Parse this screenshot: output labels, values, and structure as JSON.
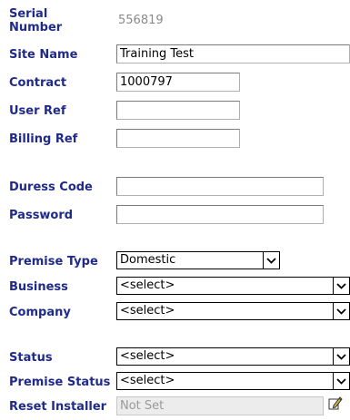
{
  "form": {
    "serial_number": {
      "label": "Serial Number",
      "value": "556819"
    },
    "site_name": {
      "label": "Site Name",
      "value": "Training Test"
    },
    "contract": {
      "label": "Contract",
      "value": "1000797"
    },
    "user_ref": {
      "label": "User Ref",
      "value": ""
    },
    "billing_ref": {
      "label": "Billing Ref",
      "value": ""
    },
    "duress_code": {
      "label": "Duress Code",
      "value": ""
    },
    "password": {
      "label": "Password",
      "value": ""
    },
    "premise_type": {
      "label": "Premise Type",
      "selected": "Domestic"
    },
    "business": {
      "label": "Business",
      "selected": "<select>"
    },
    "company": {
      "label": "Company",
      "selected": "<select>"
    },
    "status": {
      "label": "Status",
      "selected": "<select>"
    },
    "premise_status": {
      "label": "Premise Status",
      "selected": "<select>"
    },
    "reset_installer": {
      "label": "Reset Installer",
      "value": "Not Set"
    }
  },
  "icons": {
    "edit": "edit-pencil-icon"
  },
  "colors": {
    "label": "#1f2a8a",
    "read_only_value": "#8a8a8a"
  }
}
